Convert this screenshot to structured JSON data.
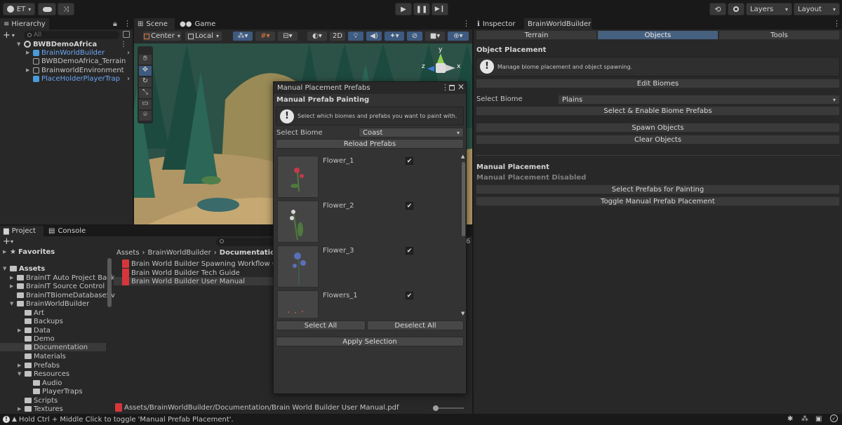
{
  "toolbar": {
    "account_label": "ET",
    "layers_label": "Layers",
    "layout_label": "Layout"
  },
  "hierarchy": {
    "tab_label": "Hierarchy",
    "search_placeholder": "All",
    "items": [
      {
        "label": "BWBDemoAfrica"
      },
      {
        "label": "BrainWorldBuilder"
      },
      {
        "label": "BWBDemoAfrica_Terrain"
      },
      {
        "label": "BrainworldEnvironment"
      },
      {
        "label": "PlaceHolderPlayerTrap"
      }
    ]
  },
  "scene": {
    "tabs": [
      {
        "label": "Scene"
      },
      {
        "label": "Game"
      }
    ],
    "pivot_label": "Center",
    "space_label": "Local",
    "mode_2d_label": "2D",
    "gizmo_axes": {
      "y": "y",
      "z": "z",
      "x": "x"
    }
  },
  "inspector": {
    "tabs": [
      {
        "label": "Inspector"
      },
      {
        "label": "BrainWorldBuilder"
      }
    ],
    "subtabs": [
      {
        "label": "Terrain"
      },
      {
        "label": "Objects"
      },
      {
        "label": "Tools"
      }
    ],
    "object_placement_title": "Object Placement",
    "help_text": "Manage biome placement and object spawning.",
    "edit_biomes_label": "Edit Biomes",
    "select_biome_label": "Select Biome",
    "select_biome_value": "Plains",
    "select_enable_label": "Select & Enable Biome Prefabs",
    "spawn_label": "Spawn Objects",
    "clear_label": "Clear Objects",
    "manual_title": "Manual Placement",
    "manual_status": "Manual Placement Disabled",
    "select_painting_label": "Select Prefabs for Painting",
    "toggle_manual_label": "Toggle Manual Prefab Placement"
  },
  "mpp": {
    "title": "Manual Placement Prefabs",
    "heading": "Manual Prefab Painting",
    "help_text": "Select which biomes and prefabs you want to paint with.",
    "select_biome_label": "Select Biome",
    "select_biome_value": "Coast",
    "reload_label": "Reload Prefabs",
    "prefabs": [
      {
        "name": "Flower_1",
        "checked": true
      },
      {
        "name": "Flower_2",
        "checked": true
      },
      {
        "name": "Flower_3",
        "checked": true
      },
      {
        "name": "Flowers_1",
        "checked": true
      }
    ],
    "select_all_label": "Select All",
    "deselect_all_label": "Deselect All",
    "apply_label": "Apply Selection"
  },
  "project": {
    "tabs": [
      {
        "label": "Project"
      },
      {
        "label": "Console"
      }
    ],
    "slider_count": "6",
    "favorites_label": "Favorites",
    "assets_label": "Assets",
    "tree": [
      {
        "label": "BrainIT Auto Project Back"
      },
      {
        "label": "BrainIT Source Control"
      },
      {
        "label": "BrainITBiomeDatabaseSv"
      },
      {
        "label": "BrainWorldBuilder"
      },
      {
        "label": "Art"
      },
      {
        "label": "Backups"
      },
      {
        "label": "Data"
      },
      {
        "label": "Demo"
      },
      {
        "label": "Documentation"
      },
      {
        "label": "Materials"
      },
      {
        "label": "Prefabs"
      },
      {
        "label": "Resources"
      },
      {
        "label": "Audio"
      },
      {
        "label": "PlayerTraps"
      },
      {
        "label": "Scripts"
      },
      {
        "label": "Textures"
      }
    ],
    "breadcrumb": [
      {
        "label": "Assets"
      },
      {
        "label": "BrainWorldBuilder"
      },
      {
        "label": "Documentation"
      }
    ],
    "files": [
      {
        "label": "Brain World Builder Spawning Workflow Guid"
      },
      {
        "label": "Brain World Builder Tech Guide"
      },
      {
        "label": "Brain World Builder User Manual"
      }
    ],
    "selected_path": "Assets/BrainWorldBuilder/Documentation/Brain World Builder User Manual.pdf"
  },
  "status": {
    "message": "Hold Ctrl + Middle Click to toggle 'Manual Prefab Placement'."
  }
}
